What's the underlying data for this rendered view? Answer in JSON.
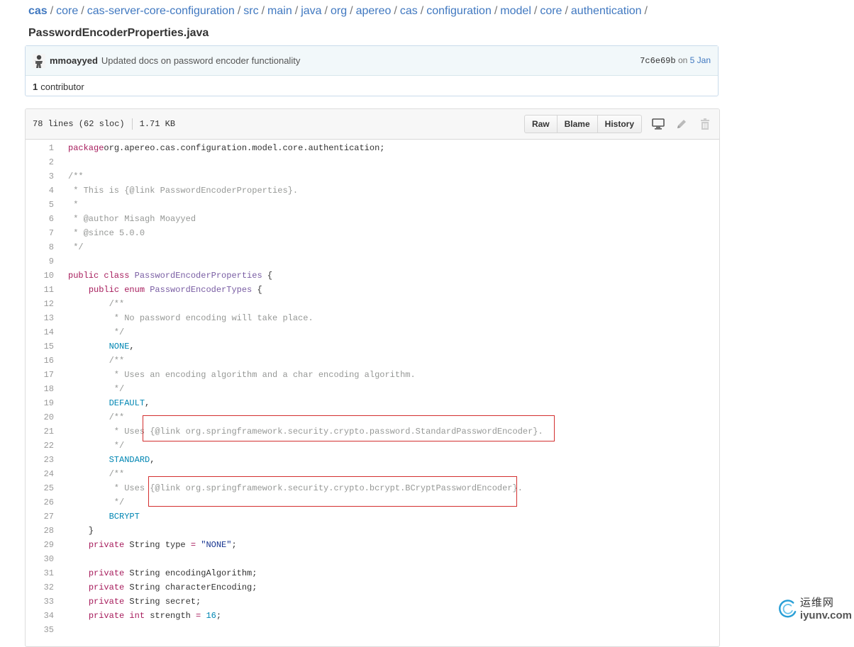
{
  "breadcrumb": {
    "root": "cas",
    "parts": [
      "core",
      "cas-server-core-configuration",
      "src",
      "main",
      "java",
      "org",
      "apereo",
      "cas",
      "configuration",
      "model",
      "core",
      "authentication"
    ],
    "trailing_sep": "/",
    "file": "PasswordEncoderProperties.java"
  },
  "commit": {
    "author": "mmoayyed",
    "message": "Updated docs on password encoder functionality",
    "sha": "7c6e69b",
    "on": "on",
    "date": "5 Jan",
    "contributors_count": "1",
    "contributors_label": "contributor"
  },
  "file": {
    "lines_info": "78 lines (62 sloc)",
    "size": "1.71 KB",
    "buttons": {
      "raw": "Raw",
      "blame": "Blame",
      "history": "History"
    },
    "icons": [
      "desktop-icon",
      "pencil-icon",
      "trash-icon"
    ]
  },
  "code_lines": [
    {
      "n": "1",
      "parts": [
        [
          "k",
          "package"
        ],
        [
          "",
          "org.apereo.cas.configuration.model.core.authentication;"
        ]
      ]
    },
    {
      "n": "2",
      "parts": []
    },
    {
      "n": "3",
      "parts": [
        [
          "c",
          "/**"
        ]
      ]
    },
    {
      "n": "4",
      "parts": [
        [
          "c",
          " * This is {@link PasswordEncoderProperties}."
        ]
      ]
    },
    {
      "n": "5",
      "parts": [
        [
          "c",
          " *"
        ]
      ]
    },
    {
      "n": "6",
      "parts": [
        [
          "c",
          " * @author Misagh Moayyed"
        ]
      ]
    },
    {
      "n": "7",
      "parts": [
        [
          "c",
          " * @since 5.0.0"
        ]
      ]
    },
    {
      "n": "8",
      "parts": [
        [
          "c",
          " */"
        ]
      ]
    },
    {
      "n": "9",
      "parts": []
    },
    {
      "n": "10",
      "parts": [
        [
          "k",
          "public class "
        ],
        [
          "t",
          "PasswordEncoderProperties"
        ],
        [
          "",
          " {"
        ]
      ]
    },
    {
      "n": "11",
      "parts": [
        [
          "",
          "    "
        ],
        [
          "k",
          "public enum "
        ],
        [
          "t",
          "PasswordEncoderTypes"
        ],
        [
          "",
          " {"
        ]
      ]
    },
    {
      "n": "12",
      "parts": [
        [
          "c",
          "        /**"
        ]
      ]
    },
    {
      "n": "13",
      "parts": [
        [
          "c",
          "         * No password encoding will take place."
        ]
      ]
    },
    {
      "n": "14",
      "parts": [
        [
          "c",
          "         */"
        ]
      ]
    },
    {
      "n": "15",
      "parts": [
        [
          "",
          "        "
        ],
        [
          "e",
          "NONE"
        ],
        [
          "",
          ","
        ]
      ]
    },
    {
      "n": "16",
      "parts": [
        [
          "c",
          "        /**"
        ]
      ]
    },
    {
      "n": "17",
      "parts": [
        [
          "c",
          "         * Uses an encoding algorithm and a char encoding algorithm."
        ]
      ]
    },
    {
      "n": "18",
      "parts": [
        [
          "c",
          "         */"
        ]
      ]
    },
    {
      "n": "19",
      "parts": [
        [
          "",
          "        "
        ],
        [
          "e",
          "DEFAULT"
        ],
        [
          "",
          ","
        ]
      ]
    },
    {
      "n": "20",
      "parts": [
        [
          "c",
          "        /**"
        ]
      ]
    },
    {
      "n": "21",
      "parts": [
        [
          "c",
          "         * Uses {@link org.springframework.security.crypto.password.StandardPasswordEncoder}."
        ]
      ]
    },
    {
      "n": "22",
      "parts": [
        [
          "c",
          "         */"
        ]
      ]
    },
    {
      "n": "23",
      "parts": [
        [
          "",
          "        "
        ],
        [
          "e",
          "STANDARD"
        ],
        [
          "",
          ","
        ]
      ]
    },
    {
      "n": "24",
      "parts": [
        [
          "c",
          "        /**"
        ]
      ]
    },
    {
      "n": "25",
      "parts": [
        [
          "c",
          "         * Uses {@link org.springframework.security.crypto.bcrypt.BCryptPasswordEncoder}."
        ]
      ]
    },
    {
      "n": "26",
      "parts": [
        [
          "c",
          "         */"
        ]
      ]
    },
    {
      "n": "27",
      "parts": [
        [
          "",
          "        "
        ],
        [
          "e",
          "BCRYPT"
        ]
      ]
    },
    {
      "n": "28",
      "parts": [
        [
          "",
          "    }"
        ]
      ]
    },
    {
      "n": "29",
      "parts": [
        [
          "",
          "    "
        ],
        [
          "k",
          "private "
        ],
        [
          "",
          "String type "
        ],
        [
          "k",
          "="
        ],
        [
          "",
          " "
        ],
        [
          "s",
          "\"NONE\""
        ],
        [
          "",
          ";"
        ]
      ]
    },
    {
      "n": "30",
      "parts": []
    },
    {
      "n": "31",
      "parts": [
        [
          "",
          "    "
        ],
        [
          "k",
          "private "
        ],
        [
          "",
          "String encodingAlgorithm;"
        ]
      ]
    },
    {
      "n": "32",
      "parts": [
        [
          "",
          "    "
        ],
        [
          "k",
          "private "
        ],
        [
          "",
          "String characterEncoding;"
        ]
      ]
    },
    {
      "n": "33",
      "parts": [
        [
          "",
          "    "
        ],
        [
          "k",
          "private "
        ],
        [
          "",
          "String secret;"
        ]
      ]
    },
    {
      "n": "34",
      "parts": [
        [
          "",
          "    "
        ],
        [
          "k",
          "private int "
        ],
        [
          "",
          "strength "
        ],
        [
          "k",
          "="
        ],
        [
          "",
          " "
        ],
        [
          "e",
          "16"
        ],
        [
          "",
          ";"
        ]
      ]
    },
    {
      "n": "35",
      "parts": []
    }
  ],
  "watermark": {
    "cn": "运维网",
    "url": "iyunv.com"
  }
}
